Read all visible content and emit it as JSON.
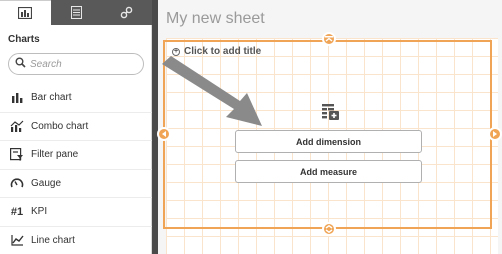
{
  "sheet_title": "My new sheet",
  "panel": {
    "tabs": [
      {
        "icon": "chart-tab-icon",
        "active": true
      },
      {
        "icon": "list-tab-icon",
        "active": false
      },
      {
        "icon": "link-tab-icon",
        "active": false
      }
    ],
    "section_title": "Charts",
    "search_placeholder": "Search",
    "items": [
      {
        "label": "Bar chart",
        "icon": "bar-chart-icon"
      },
      {
        "label": "Combo chart",
        "icon": "combo-chart-icon"
      },
      {
        "label": "Filter pane",
        "icon": "filter-pane-icon"
      },
      {
        "label": "Gauge",
        "icon": "gauge-icon"
      },
      {
        "label": "KPI",
        "icon": "kpi-icon",
        "glyph": "#1"
      },
      {
        "label": "Line chart",
        "icon": "line-chart-icon"
      }
    ]
  },
  "viz": {
    "click_title": "Click to add title",
    "add_dimension_label": "Add dimension",
    "add_measure_label": "Add measure"
  },
  "colors": {
    "accent": "#f0a455",
    "grid": "#fbe4cc",
    "tab_bar": "#595959",
    "arrow": "#8a8a8a"
  }
}
